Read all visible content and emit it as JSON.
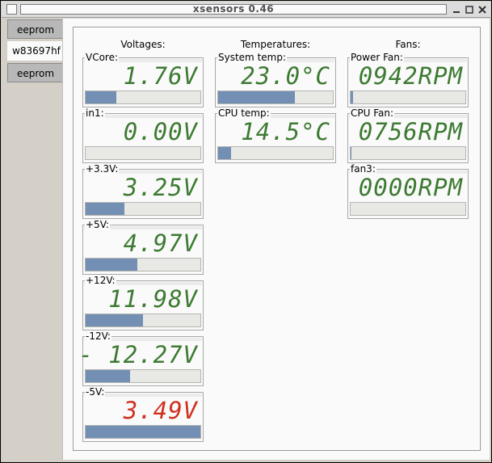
{
  "window": {
    "title": "xsensors 0.46"
  },
  "tabs": [
    {
      "label": "eeprom",
      "active": false
    },
    {
      "label": "w83697hf",
      "active": true
    },
    {
      "label": "eeprom",
      "active": false
    }
  ],
  "columns": {
    "voltages": "Voltages:",
    "temperatures": "Temperatures:",
    "fans": "Fans:"
  },
  "voltages": [
    {
      "label": "VCore:",
      "value": "1.76V",
      "level": 0.27,
      "alarm": false
    },
    {
      "label": "in1:",
      "value": "0.00V",
      "level": 0.0,
      "alarm": false
    },
    {
      "label": "+3.3V:",
      "value": "3.25V",
      "level": 0.34,
      "alarm": false
    },
    {
      "label": "+5V:",
      "value": "4.97V",
      "level": 0.45,
      "alarm": false
    },
    {
      "label": "+12V:",
      "value": "11.98V",
      "level": 0.5,
      "alarm": false
    },
    {
      "label": "-12V:",
      "value": "- 12.27V",
      "level": 0.39,
      "alarm": false
    },
    {
      "label": "-5V:",
      "value": "3.49V",
      "level": 1.0,
      "alarm": true
    }
  ],
  "temperatures": [
    {
      "label": "System temp:",
      "value": "23.0°C",
      "level": 0.67,
      "alarm": false
    },
    {
      "label": "CPU temp:",
      "value": "14.5°C",
      "level": 0.11,
      "alarm": false
    }
  ],
  "fans": [
    {
      "label": "Power Fan:",
      "value": "0942RPM",
      "level": 0.02,
      "alarm": false
    },
    {
      "label": "CPU Fan:",
      "value": "0756RPM",
      "level": 0.01,
      "alarm": false
    },
    {
      "label": "fan3:",
      "value": "0000RPM",
      "level": 0.0,
      "alarm": false
    }
  ],
  "colors": {
    "lcd_normal": "#3d7a32",
    "lcd_alarm": "#d03020",
    "bar_fill": "#7390b4"
  }
}
